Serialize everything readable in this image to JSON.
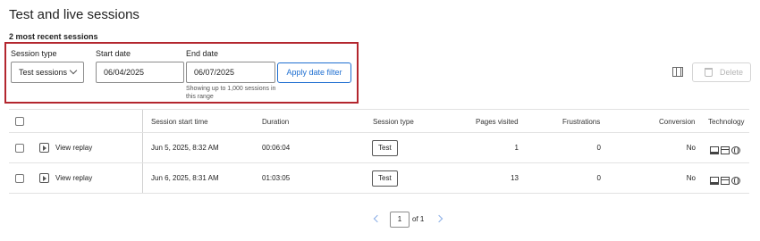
{
  "page": {
    "title": "Test and live sessions",
    "subtitle": "2 most recent sessions"
  },
  "filters": {
    "session_type_label": "Session type",
    "session_type_value": "Test sessions",
    "start_date_label": "Start date",
    "start_date_value": "06/04/2025",
    "end_date_label": "End date",
    "end_date_value": "06/07/2025",
    "apply_label": "Apply date filter",
    "hint": "Showing up to 1,000 sessions in this range"
  },
  "toolbar": {
    "delete_label": "Delete"
  },
  "table": {
    "headers": {
      "session_start": "Session start time",
      "duration": "Duration",
      "session_type": "Session type",
      "pages_visited": "Pages visited",
      "frustrations": "Frustrations",
      "conversion": "Conversion",
      "technology": "Technology"
    },
    "rows": [
      {
        "replay_label": "View replay",
        "start": "Jun 5, 2025, 8:32 AM",
        "duration": "00:06:04",
        "type": "Test",
        "pages": "1",
        "frustrations": "0",
        "conversion": "No",
        "tech_icons": [
          "monitor-icon",
          "browser-icon",
          "globe-icon"
        ]
      },
      {
        "replay_label": "View replay",
        "start": "Jun 6, 2025, 8:31 AM",
        "duration": "01:03:05",
        "type": "Test",
        "pages": "13",
        "frustrations": "0",
        "conversion": "No",
        "tech_icons": [
          "monitor-icon",
          "browser-icon",
          "globe-icon"
        ]
      }
    ]
  },
  "pagination": {
    "current": "1",
    "total_label": "of 1"
  },
  "colors": {
    "highlight_border": "#b3262e",
    "accent": "#1f6fd1"
  }
}
